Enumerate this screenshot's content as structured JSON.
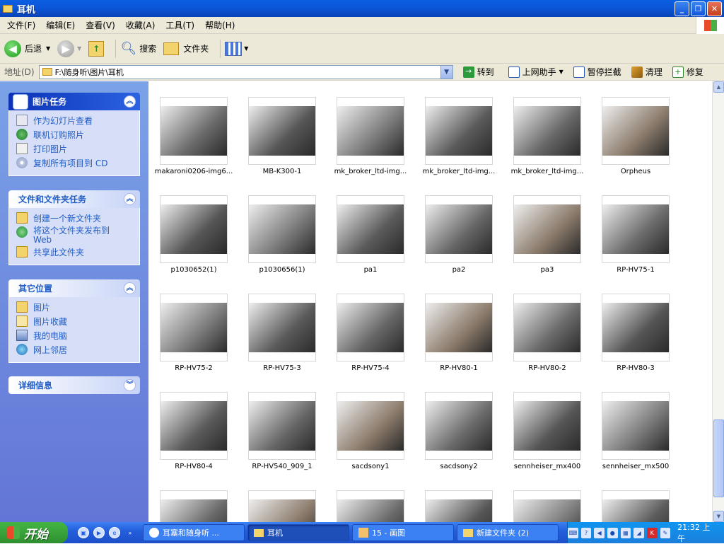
{
  "window": {
    "title": "耳机"
  },
  "menu": [
    "文件(F)",
    "编辑(E)",
    "查看(V)",
    "收藏(A)",
    "工具(T)",
    "帮助(H)"
  ],
  "toolbar": {
    "back": "后退",
    "search": "搜索",
    "folders": "文件夹"
  },
  "address": {
    "label": "地址(D)",
    "path": "F:\\随身听\\图片\\耳机",
    "go": "转到",
    "buttons": [
      "上网助手",
      "暂停拦截",
      "清理",
      "修复"
    ]
  },
  "sidebar": {
    "panels": [
      {
        "title": "图片任务",
        "items": [
          "作为幻灯片查看",
          "联机订购照片",
          "打印图片",
          "复制所有项目到 CD"
        ]
      },
      {
        "title": "文件和文件夹任务",
        "items": [
          "创建一个新文件夹",
          "将这个文件夹发布到 Web",
          "共享此文件夹"
        ]
      },
      {
        "title": "其它位置",
        "items": [
          "图片",
          "图片收藏",
          "我的电脑",
          "网上邻居"
        ]
      },
      {
        "title": "详细信息",
        "items": []
      }
    ]
  },
  "files": [
    "makaroni0206-img6...",
    "MB-K300-1",
    "mk_broker_ltd-img...",
    "mk_broker_ltd-img...",
    "mk_broker_ltd-img...",
    "Orpheus",
    "p1030652(1)",
    "p1030656(1)",
    "pa1",
    "pa2",
    "pa3",
    "RP-HV75-1",
    "RP-HV75-2",
    "RP-HV75-3",
    "RP-HV75-4",
    "RP-HV80-1",
    "RP-HV80-2",
    "RP-HV80-3",
    "RP-HV80-4",
    "RP-HV540_909_1",
    "sacdsony1",
    "sacdsony2",
    "sennheiser_mx400",
    "sennheiser_mx500",
    "",
    "",
    "",
    "",
    "",
    ""
  ],
  "taskbar": {
    "start": "开始",
    "tasks": [
      "耳塞和随身听 ...",
      "耳机",
      "15 - 画图",
      "新建文件夹 (2)"
    ],
    "clock": "21:32 上午"
  },
  "colors": {
    "titlebar": "#0b57d8",
    "sidebar": "#6f8fe0",
    "taskbar": "#245edc",
    "start": "#3a9a3a"
  }
}
